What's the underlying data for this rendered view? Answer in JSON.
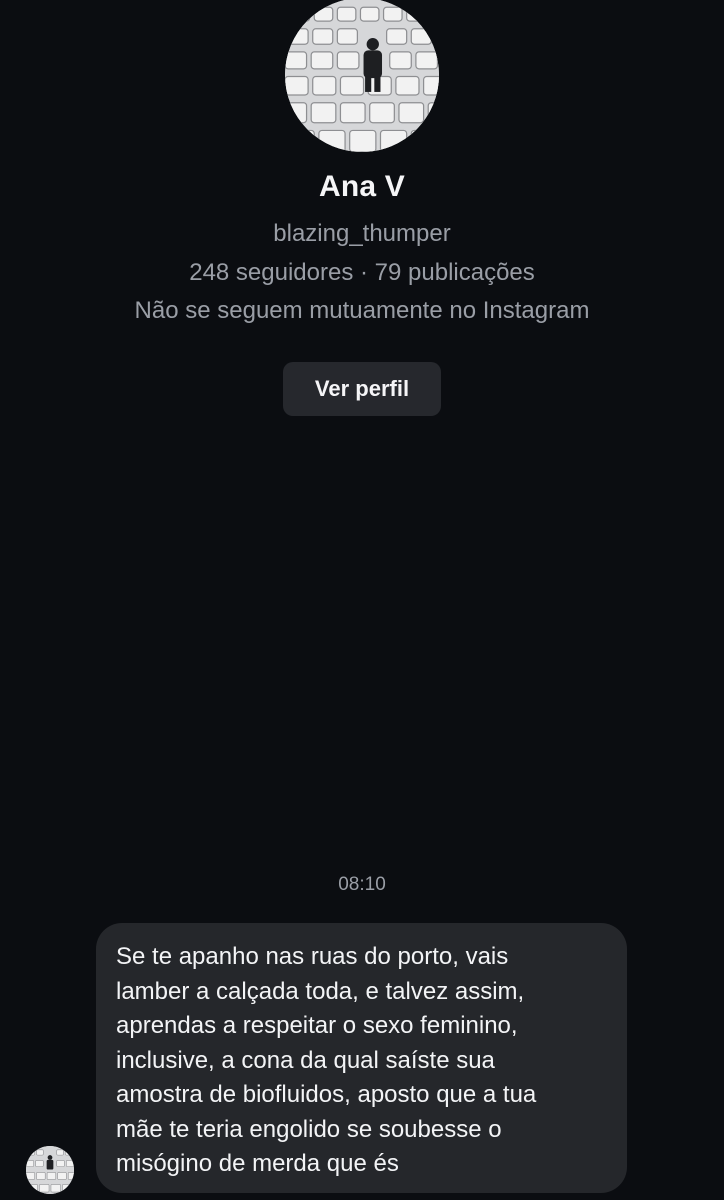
{
  "profile": {
    "name": "Ana V",
    "username": "blazing_thumper",
    "stats": "248 seguidores · 79 publicações",
    "mutual_note": "Não se seguem mutuamente no Instagram",
    "view_profile_label": "Ver perfil"
  },
  "conversation": {
    "timestamp": "08:10",
    "messages": [
      {
        "sender": "other",
        "lines": [
          "Se te apanho nas ruas do porto, vais",
          "lamber a calçada toda, e talvez assim,",
          "aprendas a respeitar o sexo feminino,",
          "inclusive, a cona da qual saíste sua",
          "amostra de biofluidos, aposto que a tua",
          "mãe te teria engolido se soubesse o",
          "misógino de merda que és"
        ]
      }
    ]
  },
  "colors": {
    "background": "#0b0d11",
    "bubble": "#25272b",
    "button": "#26282d",
    "secondary_text": "#9a9ea6",
    "primary_text": "#f3f4f6"
  }
}
